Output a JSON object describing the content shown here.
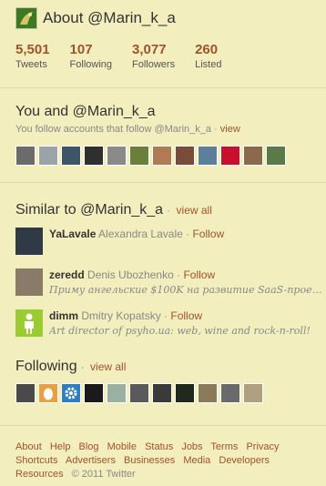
{
  "header": {
    "title": "About @Marin_k_a"
  },
  "stats": [
    {
      "number": "5,501",
      "label": "Tweets"
    },
    {
      "number": "107",
      "label": "Following"
    },
    {
      "number": "3,077",
      "label": "Followers"
    },
    {
      "number": "260",
      "label": "Listed"
    }
  ],
  "you_and": {
    "title": "You and @Marin_k_a",
    "subtitle": "You follow accounts that follow @Marin_k_a",
    "view_link": "view",
    "avatar_colors": [
      "#6b6b6b",
      "#9aa3a8",
      "#3d5566",
      "#2f2f2f",
      "#8a8a8a",
      "#6a7f3a",
      "#b07a55",
      "#7a4a3a",
      "#5c7f9a",
      "#c8102e",
      "#8a6a4a",
      "#5a7a4a"
    ]
  },
  "similar": {
    "title": "Similar to @Marin_k_a",
    "view_all": "view all",
    "items": [
      {
        "username": "YaLavale",
        "fullname": "Alexandra Lavale",
        "follow": "Follow",
        "bio": "",
        "color": "#2f3a44"
      },
      {
        "username": "zeredd",
        "fullname": "Denis Ubozhenko",
        "follow": "Follow",
        "bio": "Приму ангельские $100K на развитие SaaS-проек...",
        "color": "#8a7a6a"
      },
      {
        "username": "dimm",
        "fullname": "Dmitry Kopatsky",
        "follow": "Follow",
        "bio": "Art director of psyho.ua: web, wine and rock-n-roll!",
        "color": "#9acd32"
      }
    ]
  },
  "following": {
    "title": "Following",
    "view_all": "view all",
    "avatar_colors": [
      "#4a4a4a",
      "#e8a040",
      "#2f7fc0",
      "#1a1a1a",
      "#9ab0a0",
      "#5a5a5a",
      "#3a3a3a",
      "#1f2a1f",
      "#8a7a5a",
      "#6a6a6a",
      "#b0a080"
    ]
  },
  "footer": {
    "links": [
      "About",
      "Help",
      "Blog",
      "Mobile",
      "Status",
      "Jobs",
      "Terms",
      "Privacy",
      "Shortcuts",
      "Advertisers",
      "Businesses",
      "Media",
      "Developers",
      "Resources"
    ],
    "copyright": "© 2011 Twitter"
  }
}
